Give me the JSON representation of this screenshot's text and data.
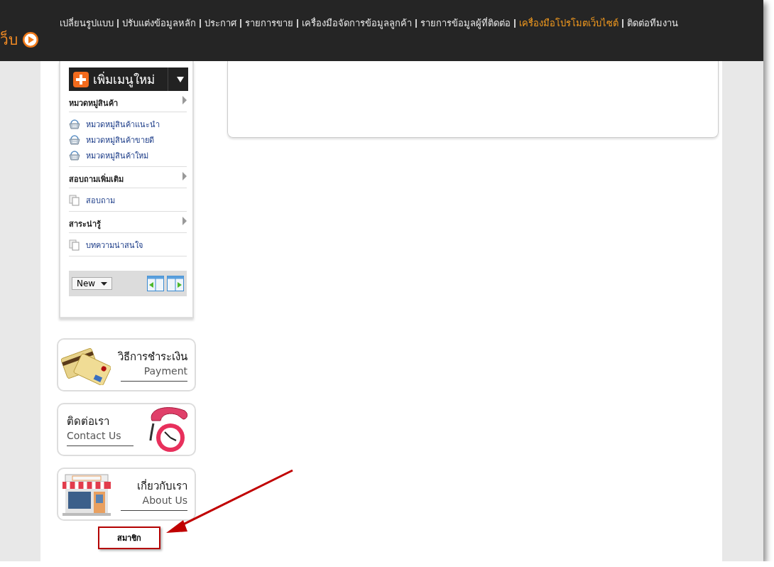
{
  "header": {
    "logo_text": "ว็บ",
    "nav": [
      {
        "label": "เปลี่ยนรูปแบบ",
        "selected": false
      },
      {
        "label": "ปรับแต่งข้อมูลหลัก",
        "selected": false
      },
      {
        "label": "ประกาศ",
        "selected": false
      },
      {
        "label": "รายการขาย",
        "selected": false
      },
      {
        "label": "เครื่องมือจัดการข้อมูลลูกค้า",
        "selected": false
      },
      {
        "label": "รายการข้อมูลผู้ที่ติดต่อ",
        "selected": false
      },
      {
        "label": "เครื่องมือโปรโมตเว็บไซต์",
        "selected": true
      },
      {
        "label": "ติดต่อทีมงาน",
        "selected": false
      }
    ]
  },
  "sidebar": {
    "add_menu_button": "เพิ่มเมนูใหม่",
    "sections": [
      {
        "title": "หมวดหมู่สินค้า",
        "items": [
          {
            "label": "หมวดหมู่สินค้าแนะนำ",
            "kind": "basket"
          },
          {
            "label": "หมวดหมู่สินค้าขายดี",
            "kind": "basket"
          },
          {
            "label": "หมวดหมู่สินค้าใหม่",
            "kind": "basket"
          }
        ]
      },
      {
        "title": "สอบถามเพิ่มเติม",
        "items": [
          {
            "label": "สอบถาม",
            "kind": "pages"
          }
        ]
      },
      {
        "title": "สาระน่ารู้",
        "items": [
          {
            "label": "บทความน่าสนใจ",
            "kind": "pages"
          }
        ]
      }
    ],
    "footer": {
      "dropdown": "New"
    }
  },
  "banners": [
    {
      "title": "วิธีการชำระเงิน",
      "subtitle": "Payment",
      "kind": "cards"
    },
    {
      "title": "ติดต่อเรา",
      "subtitle": "Contact Us",
      "kind": "phone"
    },
    {
      "title": "เกี่ยวกับเรา",
      "subtitle": "About Us",
      "kind": "shop"
    }
  ],
  "member_box": {
    "label": "สมาชิก"
  }
}
